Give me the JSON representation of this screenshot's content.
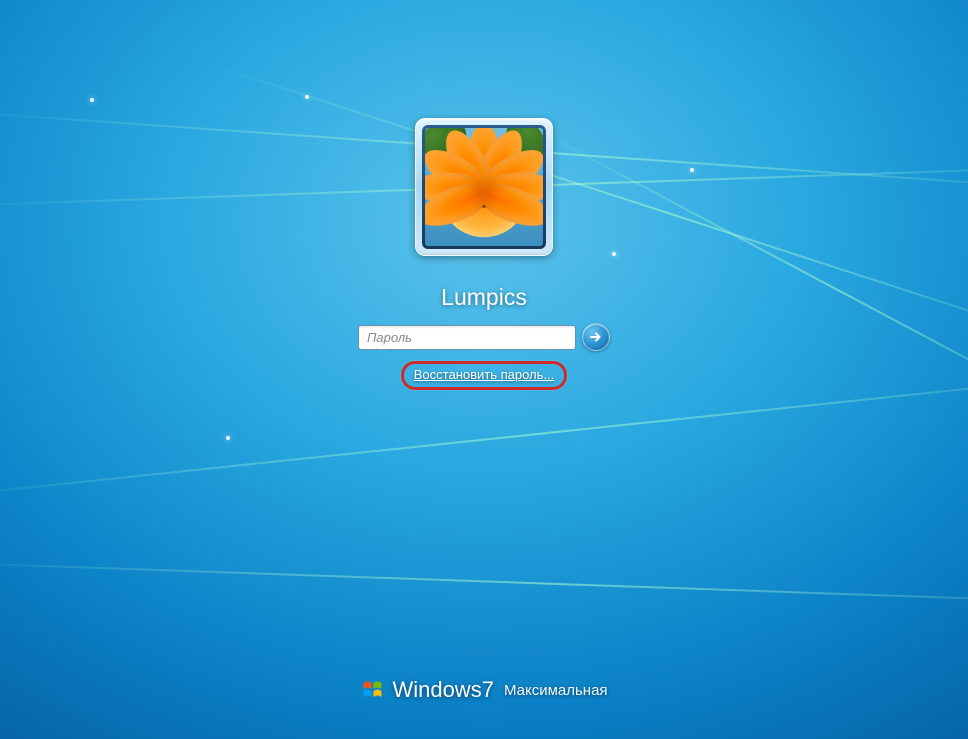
{
  "user": {
    "name": "Lumpics",
    "avatar_icon": "orange-flower"
  },
  "password": {
    "placeholder": "Пароль",
    "value": ""
  },
  "reset_link": {
    "label": "Восстановить пароль..."
  },
  "branding": {
    "os_name": "Windows",
    "os_version": "7",
    "edition": "Максимальная"
  },
  "icons": {
    "submit": "arrow-right-icon",
    "logo": "windows-logo"
  },
  "colors": {
    "highlight_border": "#cf2a2a",
    "link": "#ffffff"
  }
}
